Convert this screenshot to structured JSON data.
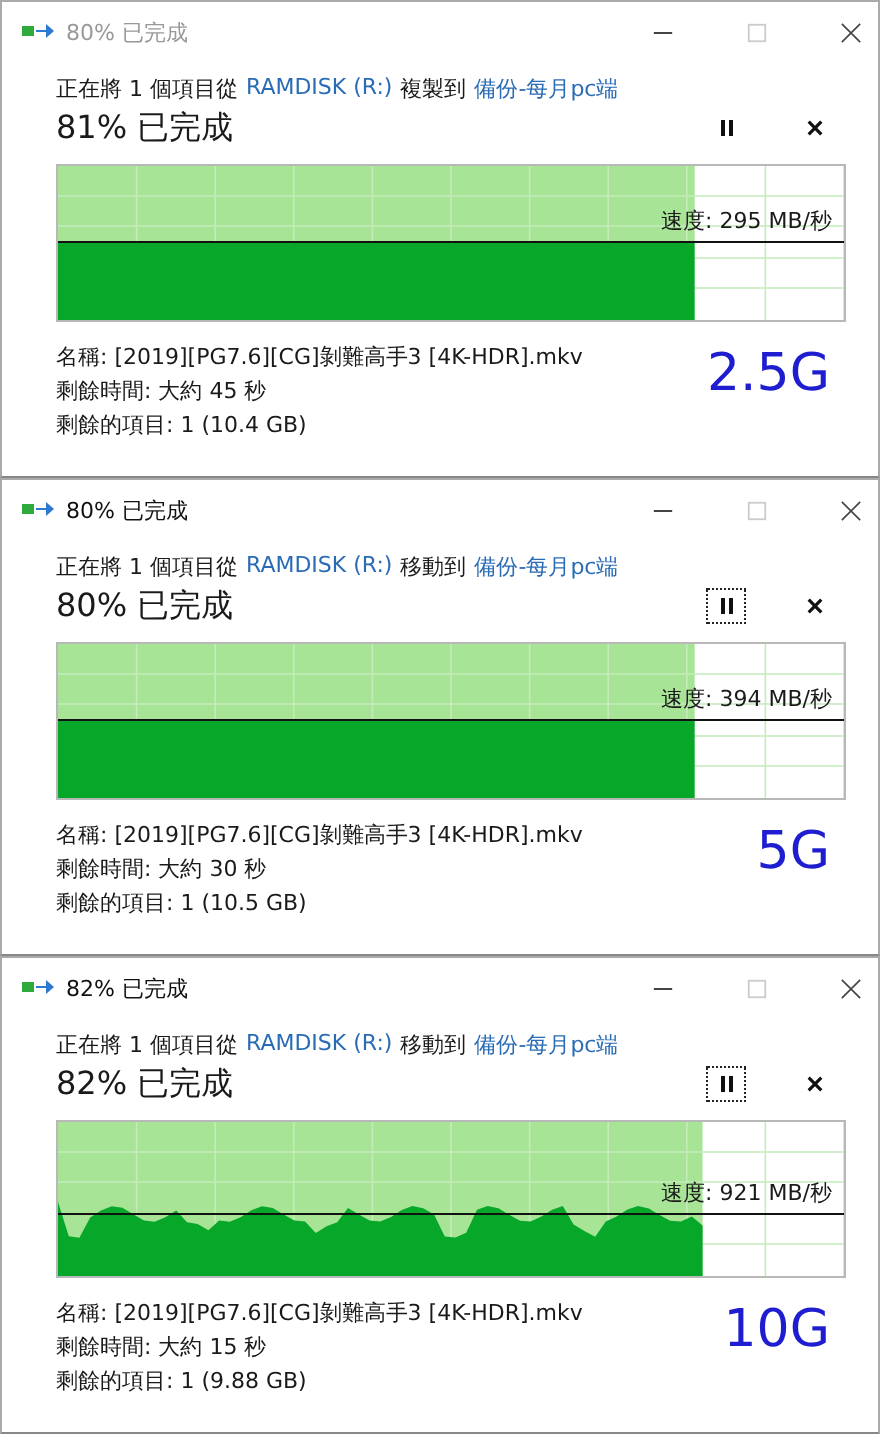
{
  "windows": [
    {
      "title": "80% 已完成",
      "active": false,
      "prefix": "正在將 1 個項目從",
      "source": "RAMDISK (R:)",
      "action": "複製到",
      "destination": "備份-每月pc端",
      "percent": "81% 已完成",
      "pause_focused": false,
      "level": 0.81,
      "speed": "速度: 295 MB/秒",
      "name": "名稱: [2019][PG7.6][CG]剝難高手3 [4K-HDR].mkv",
      "time": "剩餘時間: 大約 45 秒",
      "items": "剩餘的項目: 1 (10.4 GB)",
      "note": "2.5G"
    },
    {
      "title": "80% 已完成",
      "active": true,
      "prefix": "正在將 1 個項目從",
      "source": "RAMDISK (R:)",
      "action": "移動到",
      "destination": "備份-每月pc端",
      "percent": "80% 已完成",
      "pause_focused": true,
      "level": 0.81,
      "speed": "速度: 394 MB/秒",
      "name": "名稱: [2019][PG7.6][CG]剝難高手3 [4K-HDR].mkv",
      "time": "剩餘時間: 大約 30 秒",
      "items": "剩餘的項目: 1 (10.5 GB)",
      "note": "5G"
    },
    {
      "title": "82% 已完成",
      "active": true,
      "prefix": "正在將 1 個項目從",
      "source": "RAMDISK (R:)",
      "action": "移動到",
      "destination": "備份-每月pc端",
      "percent": "82% 已完成",
      "pause_focused": true,
      "level": 0.82,
      "speed": "速度: 921 MB/秒",
      "name": "名稱: [2019][PG7.6][CG]剝難高手3 [4K-HDR].mkv",
      "time": "剩餘時間: 大約 15 秒",
      "items": "剩餘的項目: 1 (9.88 GB)",
      "note": "10G"
    }
  ]
}
